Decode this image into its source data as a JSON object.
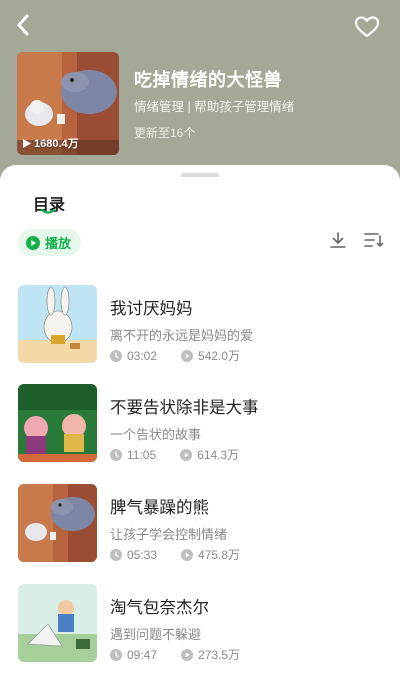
{
  "header": {
    "album": {
      "title": "吃掉情绪的大怪兽",
      "subtitle": "情绪管理 | 帮助孩子管理情绪",
      "update_text": "更新至16个",
      "play_count": "1680.4万"
    },
    "icons": {
      "back": "chevron-left-icon",
      "favorite": "heart-outline-icon"
    }
  },
  "catalog": {
    "tab_label": "目录",
    "play_button_label": "播放",
    "colors": {
      "accent": "#15b04c",
      "accent_bg": "#e6f7ec",
      "header_bg": "#a4a896"
    }
  },
  "tracks": [
    {
      "title": "我讨厌妈妈",
      "description": "离不开的永远是妈妈的爱",
      "duration": "03:02",
      "plays": "542.0万"
    },
    {
      "title": "不要告状除非是大事",
      "description": "一个告状的故事",
      "duration": "11:05",
      "plays": "614.3万"
    },
    {
      "title": "脾气暴躁的熊",
      "description": "让孩子学会控制情绪",
      "duration": "05:33",
      "plays": "475.8万"
    },
    {
      "title": "淘气包奈杰尔",
      "description": "遇到问题不躲避",
      "duration": "09:47",
      "plays": "273.5万"
    }
  ]
}
